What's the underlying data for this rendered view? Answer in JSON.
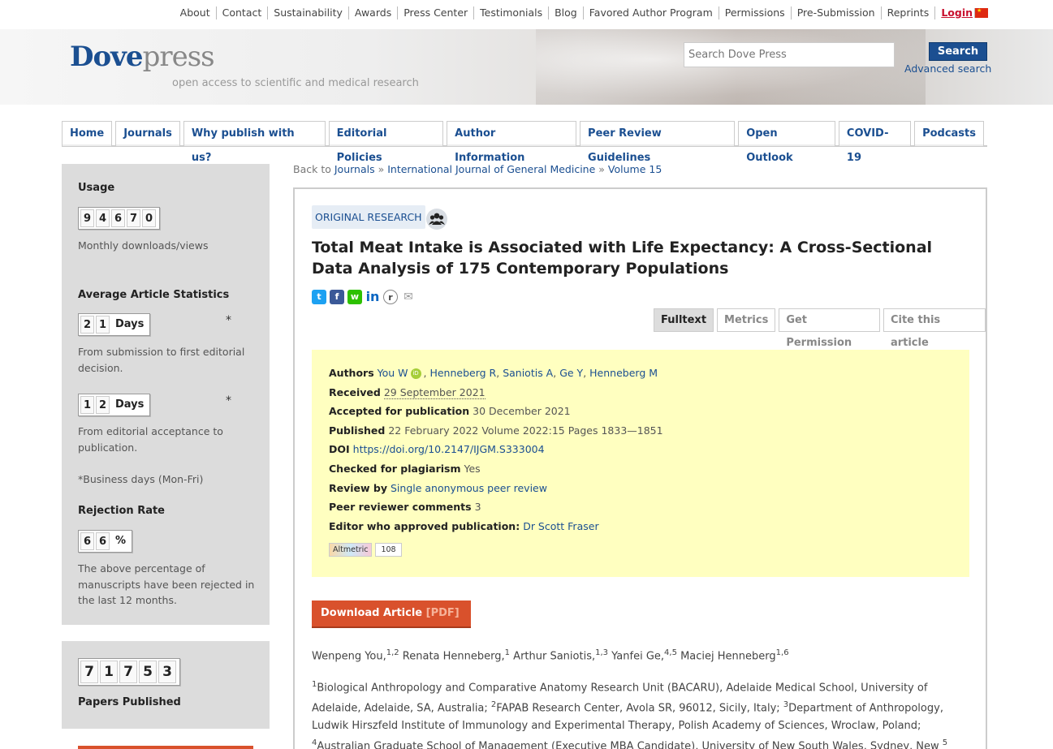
{
  "toplinks": [
    "About",
    "Contact",
    "Sustainability",
    "Awards",
    "Press Center",
    "Testimonials",
    "Blog",
    "Favored Author Program",
    "Permissions",
    "Pre-Submission",
    "Reprints"
  ],
  "login_label": "Login",
  "header": {
    "logo_dove": "Dove",
    "logo_press": "press",
    "tagline": "open access to scientific and medical research",
    "search_placeholder": "Search Dove Press",
    "search_button": "Search",
    "advanced_search": "Advanced search"
  },
  "nav": [
    "Home",
    "Journals",
    "Why publish with us?",
    "Editorial Policies",
    "Author Information",
    "Peer Review Guidelines",
    "Open Outlook",
    "COVID-19",
    "Podcasts"
  ],
  "sidebar": {
    "usage_title": "Usage",
    "usage_digits": [
      "9",
      "4",
      "6",
      "7",
      "0"
    ],
    "usage_caption": "Monthly downloads/views",
    "avg_title": "Average Article Statistics",
    "submission_digits": [
      "2",
      "1"
    ],
    "days_label": "Days",
    "asterisk": "*",
    "submission_caption": "From submission to first editorial decision.",
    "acceptance_digits": [
      "1",
      "2"
    ],
    "acceptance_caption": "From editorial acceptance to publication.",
    "business_note": "*Business days (Mon-Fri)",
    "rejection_title": "Rejection Rate",
    "rejection_digits": [
      "6",
      "6"
    ],
    "percent_label": "%",
    "rejection_caption": "The above percentage of manuscripts have been rejected in the last 12 months.",
    "papers_digits": [
      "7",
      "1",
      "7",
      "5",
      "3"
    ],
    "papers_label": "Papers Published"
  },
  "breadcrumb": {
    "prefix": "Back to",
    "journals": "Journals",
    "sep": "»",
    "journal": "International Journal of General Medicine",
    "volume": "Volume 15"
  },
  "article": {
    "badge": "ORIGINAL RESEARCH",
    "title": "Total Meat Intake is Associated with Life Expectancy: A Cross-Sectional Data Analysis of 175 Contemporary Populations",
    "tabs": [
      "Fulltext",
      "Metrics",
      "Get Permission",
      "Cite this article"
    ],
    "info": {
      "authors_label": "Authors",
      "authors": [
        "You W",
        "Henneberg R",
        "Saniotis A",
        "Ge Y",
        "Henneberg M"
      ],
      "received_label": "Received",
      "received": "29 September 2021",
      "accepted_label": "Accepted for publication",
      "accepted": "30 December 2021",
      "published_label": "Published",
      "published": "22 February 2022 Volume 2022:15 Pages 1833—1851",
      "doi_label": "DOI",
      "doi": "https://doi.org/10.2147/IJGM.S333004",
      "plagiarism_label": "Checked for plagiarism",
      "plagiarism": "Yes",
      "review_label": "Review by",
      "review": "Single anonymous peer review",
      "comments_label": "Peer reviewer comments",
      "comments": "3",
      "editor_label": "Editor who approved publication:",
      "editor": "Dr Scott Fraser",
      "altmetric_label": "Altmetric",
      "altmetric_score": "108"
    },
    "download_label": "Download Article",
    "download_pdf": "[PDF]",
    "author_names": [
      "Wenpeng You,",
      "Renata Henneberg,",
      "Arthur Saniotis,",
      "Yanfei Ge,",
      "Maciej Henneberg"
    ],
    "author_sups": [
      "1,2",
      "1",
      "1,3",
      "4,5",
      "1,6"
    ],
    "affil_nums": [
      "1",
      "2",
      "3",
      "4",
      "5"
    ],
    "affil_texts": [
      "Biological Anthropology and Comparative Anatomy Research Unit (BACARU), Adelaide Medical School, University of Adelaide, Adelaide, SA, Australia;",
      "FAPAB Research Center, Avola SR, 96012, Sicily, Italy;",
      "Department of Anthropology, Ludwik Hirszfeld Institute of Immunology and Experimental Therapy, Polish Academy of Sciences, Wroclaw, Poland;",
      "Australian Graduate School of Management (Executive MBA Candidate), University of New South Wales, Sydney, New"
    ]
  },
  "colors": {
    "brand_blue": "#1b4f91",
    "download_orange": "#d9512c",
    "info_yellow": "#ffffc0"
  }
}
